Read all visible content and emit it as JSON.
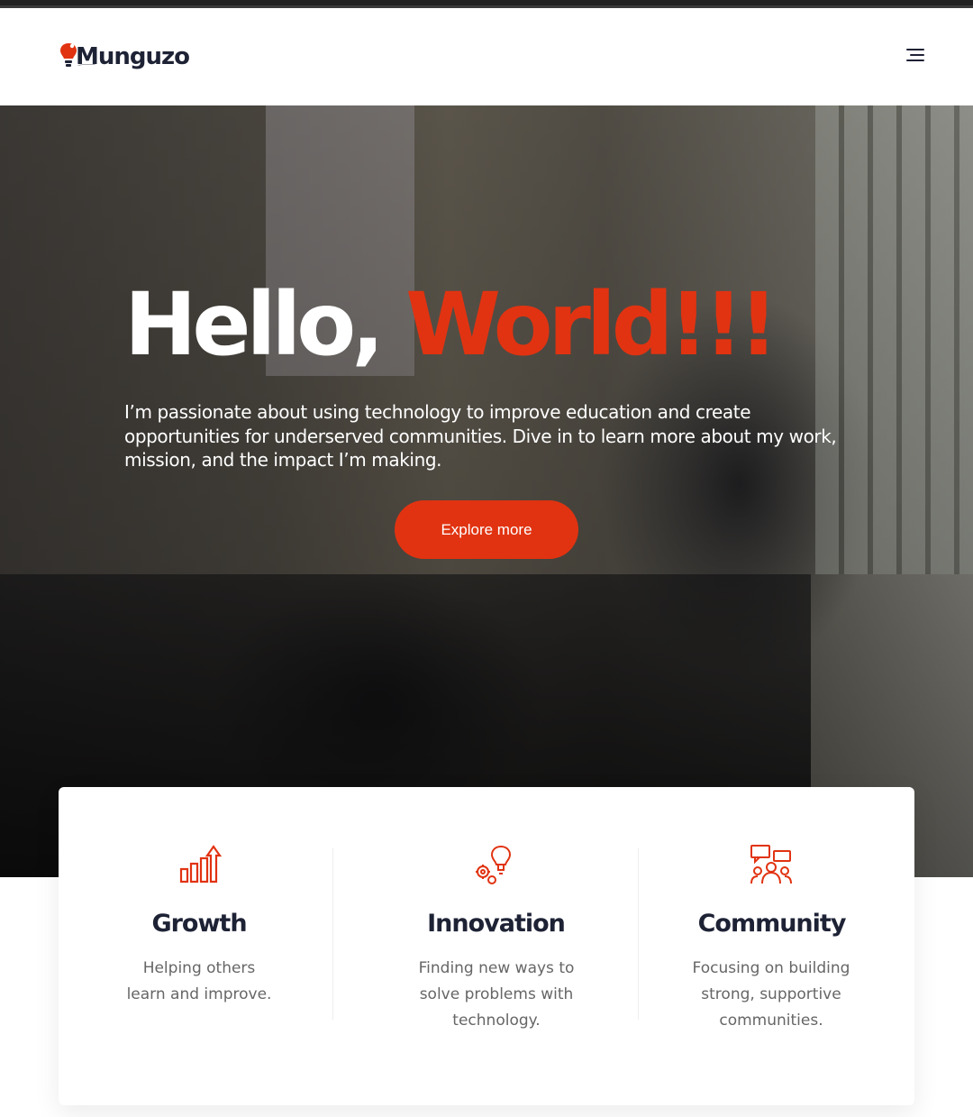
{
  "brand": {
    "name": "Munguzo",
    "accent": "#e13311",
    "dark": "#1e2235"
  },
  "header": {
    "menu_icon": "hamburger-menu-icon"
  },
  "hero": {
    "title_part1": "Hello,",
    "title_part2": "World!!!",
    "description": "I’m passionate about using technology to improve education and create opportunities for underserved communities. Dive in to learn more about my work, mission, and the impact I’m making.",
    "button_label": "Explore more"
  },
  "features": [
    {
      "icon": "growth-chart-icon",
      "title": "Growth",
      "text": "Helping others learn and improve."
    },
    {
      "icon": "innovation-lightbulb-gears-icon",
      "title": "Innovation",
      "text": "Finding new ways to solve problems with technology."
    },
    {
      "icon": "community-people-icon",
      "title": "Community",
      "text": "Focusing on building strong, supportive communities."
    }
  ]
}
